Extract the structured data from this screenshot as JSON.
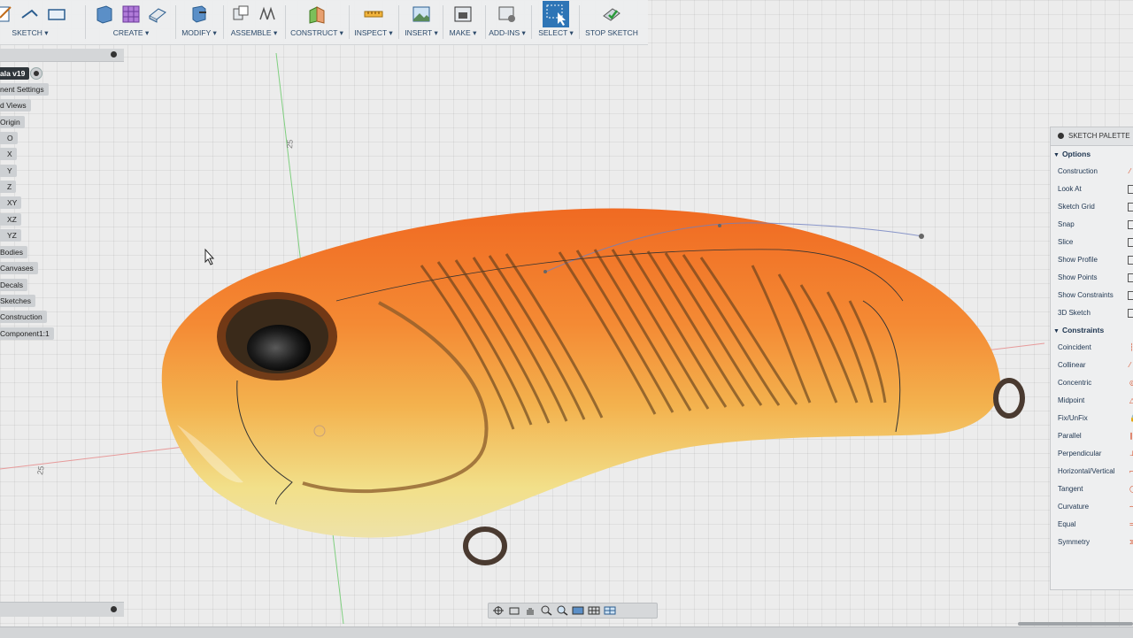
{
  "toolbar": {
    "groups": [
      {
        "label": "SKETCH",
        "arrow": "▾"
      },
      {
        "label": "CREATE",
        "arrow": "▾"
      },
      {
        "label": "MODIFY",
        "arrow": "▾"
      },
      {
        "label": "ASSEMBLE",
        "arrow": "▾"
      },
      {
        "label": "CONSTRUCT",
        "arrow": "▾"
      },
      {
        "label": "INSPECT",
        "arrow": "▾"
      },
      {
        "label": "INSERT",
        "arrow": "▾"
      },
      {
        "label": "MAKE",
        "arrow": "▾"
      },
      {
        "label": "ADD-INS",
        "arrow": "▾"
      },
      {
        "label": "SELECT",
        "arrow": "▾"
      },
      {
        "label": "STOP SKETCH",
        "arrow": ""
      }
    ]
  },
  "browser": {
    "document": "ala v19",
    "nodes": [
      "nent Settings",
      "d Views",
      "Origin",
      "O",
      "X",
      "Y",
      "Z",
      "XY",
      "XZ",
      "YZ",
      "Bodies",
      "Canvases",
      "Decals",
      "Sketches",
      "Construction",
      "Component1:1"
    ]
  },
  "viewport": {
    "ruler_top": "25",
    "ruler_left": "25"
  },
  "palette": {
    "title": "SKETCH PALETTE",
    "options_header": "Options",
    "options": [
      "Construction",
      "Look At",
      "Sketch Grid",
      "Snap",
      "Slice",
      "Show Profile",
      "Show Points",
      "Show Constraints",
      "3D Sketch"
    ],
    "constraints_header": "Constraints",
    "constraints": [
      "Coincident",
      "Collinear",
      "Concentric",
      "Midpoint",
      "Fix/UnFix",
      "Parallel",
      "Perpendicular",
      "Horizontal/Vertical",
      "Tangent",
      "Curvature",
      "Equal",
      "Symmetry"
    ]
  },
  "colors": {
    "accent_select": "#1f6fb5",
    "body_orange": "#f07a2a",
    "body_yellow": "#f4e28a",
    "constraint_red": "#d9502a"
  }
}
